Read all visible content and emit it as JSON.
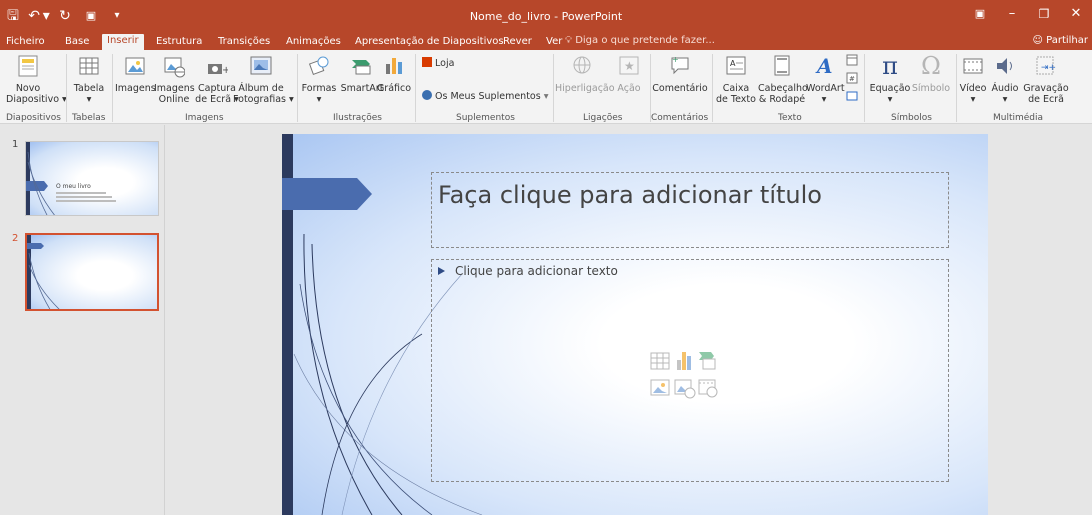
{
  "window": {
    "doc_title": "Nome_do_livro - PowerPoint",
    "share_label": "Partilhar",
    "tell_me": "Diga o que pretende fazer..."
  },
  "qat": {
    "save_icon": "save-icon",
    "undo_icon": "undo-icon",
    "redo_icon": "redo-icon"
  },
  "tabs": [
    "Ficheiro",
    "Base",
    "Inserir",
    "Estrutura",
    "Transições",
    "Animações",
    "Apresentação de Diapositivos",
    "Rever",
    "Ver"
  ],
  "active_tab": "Inserir",
  "ribbon": {
    "groups": [
      "Diapositivos",
      "Tabelas",
      "Imagens",
      "Ilustrações",
      "Suplementos",
      "Ligações",
      "Comentários",
      "Texto",
      "Símbolos",
      "Multimédia"
    ],
    "novo_diapositivo": [
      "Novo",
      "Diapositivo ▾"
    ],
    "tabela": [
      "Tabela",
      "▾"
    ],
    "imagens": "Imagens",
    "imagens_online": [
      "Imagens",
      "Online"
    ],
    "captura": [
      "Captura",
      "de Ecrã ▾"
    ],
    "album": [
      "Álbum de",
      "Fotografias ▾"
    ],
    "formas": [
      "Formas",
      "▾"
    ],
    "smartart": "SmartArt",
    "grafico": "Gráfico",
    "loja": "Loja",
    "meus_suplementos": "Os Meus Suplementos",
    "hiperligacao": "Hiperligação",
    "acao": "Ação",
    "comentario": "Comentário",
    "caixa_texto": [
      "Caixa",
      "de Texto"
    ],
    "cabecalho": [
      "Cabeçalho",
      "& Rodapé"
    ],
    "wordart": [
      "WordArt",
      "▾"
    ],
    "equacao": [
      "Equação",
      "▾"
    ],
    "simbolo": "Símbolo",
    "video": [
      "Vídeo",
      "▾"
    ],
    "audio": [
      "Áudio",
      "▾"
    ],
    "gravacao": [
      "Gravação",
      "de Ecrã"
    ]
  },
  "thumbnails": [
    {
      "number": "1",
      "text": "O meu livro"
    },
    {
      "number": "2",
      "text": ""
    }
  ],
  "slide": {
    "title_placeholder": "Faça clique para adicionar título",
    "body_placeholder": "Clique para adicionar texto"
  },
  "colors": {
    "accent": "#b7472a",
    "selection": "#d35230",
    "slide_arrow": "#4a6cae",
    "slide_bar": "#2c3a5e"
  }
}
